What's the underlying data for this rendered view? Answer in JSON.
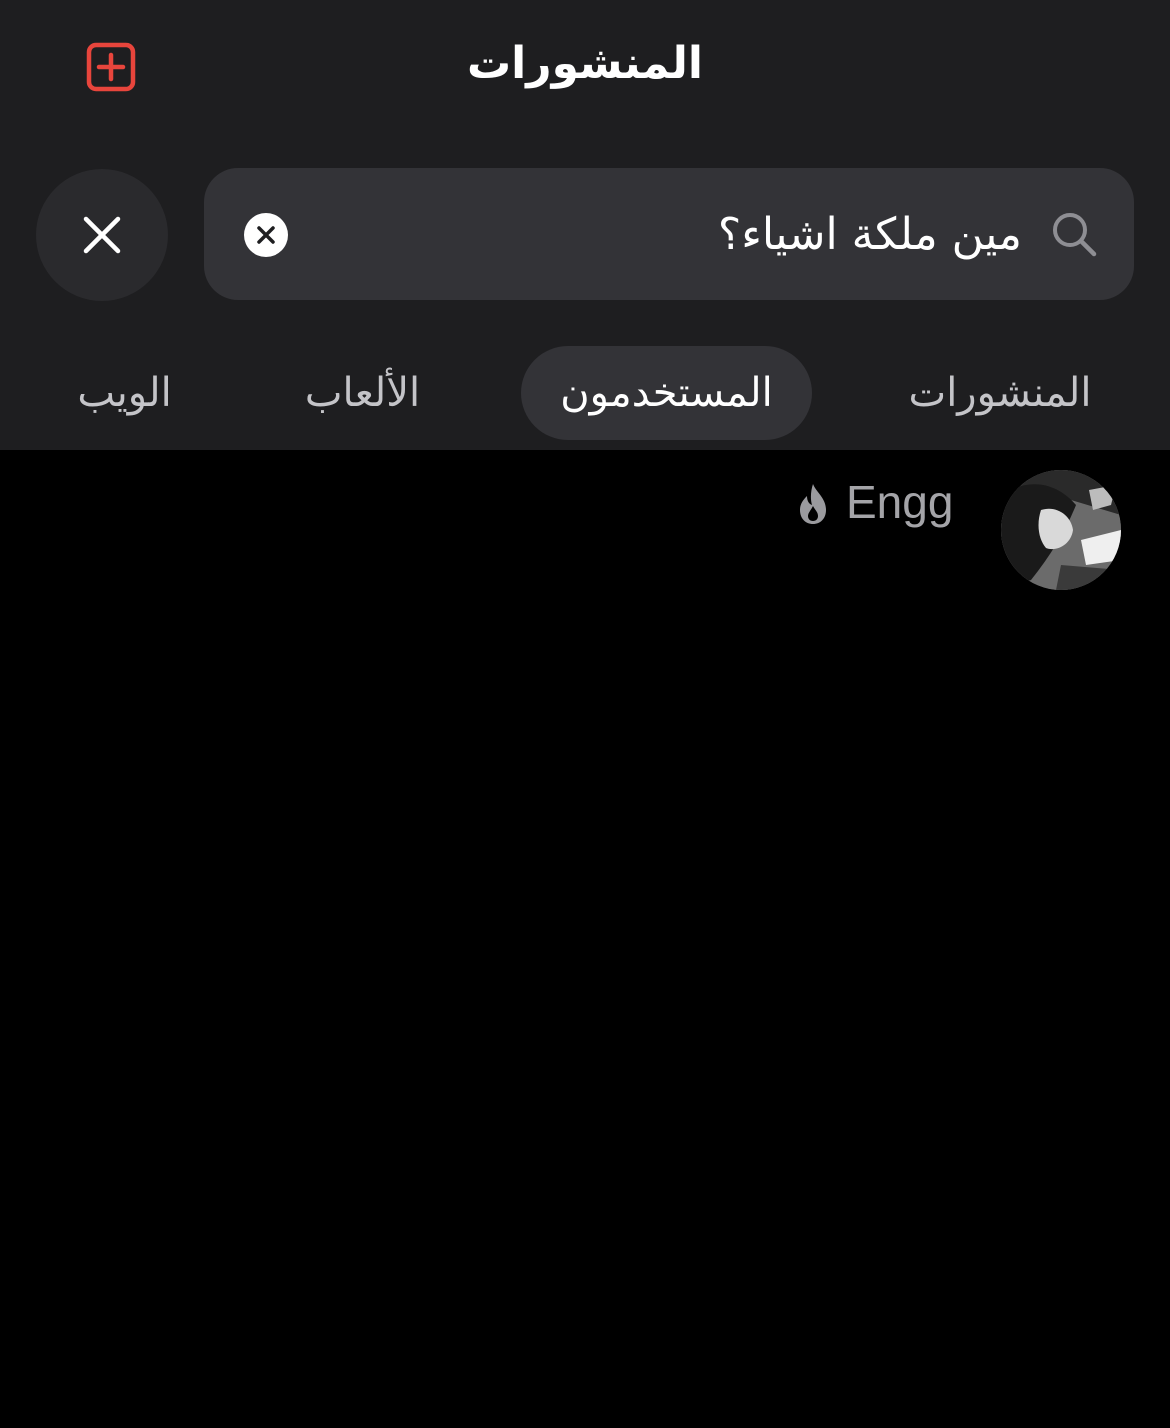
{
  "header": {
    "title": "المنشورات",
    "accent_color": "#e8453c"
  },
  "search": {
    "query": "مين ملكة اشياء؟",
    "icon": "search-icon"
  },
  "tabs": [
    {
      "label": "المنشورات",
      "active": false
    },
    {
      "label": "المستخدمون",
      "active": true
    },
    {
      "label": "الألعاب",
      "active": false
    },
    {
      "label": "الويب",
      "active": false
    }
  ],
  "results": [
    {
      "username": "Engg",
      "badge_icon": "flame-icon"
    }
  ]
}
